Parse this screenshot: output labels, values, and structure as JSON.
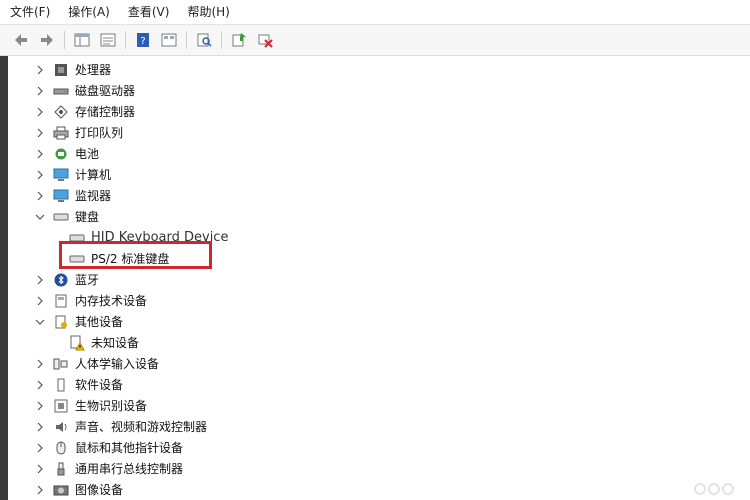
{
  "menubar": {
    "items": [
      "文件(F)",
      "操作(A)",
      "查看(V)",
      "帮助(H)"
    ]
  },
  "toolbar": {
    "buttons": [
      "back-icon",
      "forward-icon",
      "console-tree-icon",
      "properties-icon",
      "help-icon",
      "view-icon",
      "scan-hardware-icon",
      "update-driver-icon",
      "uninstall-device-icon"
    ]
  },
  "tree": {
    "items": [
      {
        "label": "处理器",
        "icon": "processor-icon",
        "expanded": false,
        "level": 1
      },
      {
        "label": "磁盘驱动器",
        "icon": "disk-drive-icon",
        "expanded": false,
        "level": 1
      },
      {
        "label": "存储控制器",
        "icon": "storage-controller-icon",
        "expanded": false,
        "level": 1
      },
      {
        "label": "打印队列",
        "icon": "printer-icon",
        "expanded": false,
        "level": 1
      },
      {
        "label": "电池",
        "icon": "battery-icon",
        "expanded": false,
        "level": 1
      },
      {
        "label": "计算机",
        "icon": "computer-icon",
        "expanded": false,
        "level": 1
      },
      {
        "label": "监视器",
        "icon": "monitor-icon",
        "expanded": false,
        "level": 1
      },
      {
        "label": "键盘",
        "icon": "keyboard-icon",
        "expanded": true,
        "level": 1
      },
      {
        "label": "HID Keyboard Device",
        "icon": "keyboard-icon",
        "level": 2
      },
      {
        "label": "PS/2 标准键盘",
        "icon": "keyboard-icon",
        "level": 2
      },
      {
        "label": "蓝牙",
        "icon": "bluetooth-icon",
        "expanded": false,
        "level": 1
      },
      {
        "label": "内存技术设备",
        "icon": "memory-device-icon",
        "expanded": false,
        "level": 1
      },
      {
        "label": "其他设备",
        "icon": "other-devices-icon",
        "expanded": true,
        "level": 1
      },
      {
        "label": "未知设备",
        "icon": "unknown-device-warning-icon",
        "level": 2
      },
      {
        "label": "人体学输入设备",
        "icon": "hid-icon",
        "expanded": false,
        "level": 1
      },
      {
        "label": "软件设备",
        "icon": "software-device-icon",
        "expanded": false,
        "level": 1
      },
      {
        "label": "生物识别设备",
        "icon": "biometric-icon",
        "expanded": false,
        "level": 1
      },
      {
        "label": "声音、视频和游戏控制器",
        "icon": "sound-icon",
        "expanded": false,
        "level": 1
      },
      {
        "label": "鼠标和其他指针设备",
        "icon": "mouse-icon",
        "expanded": false,
        "level": 1
      },
      {
        "label": "通用串行总线控制器",
        "icon": "usb-icon",
        "expanded": false,
        "level": 1
      },
      {
        "label": "图像设备",
        "icon": "imaging-device-icon",
        "expanded": false,
        "level": 1
      }
    ]
  },
  "colors": {
    "highlight": "#d0262e",
    "toolbar_bg": "#f7f7f7"
  }
}
